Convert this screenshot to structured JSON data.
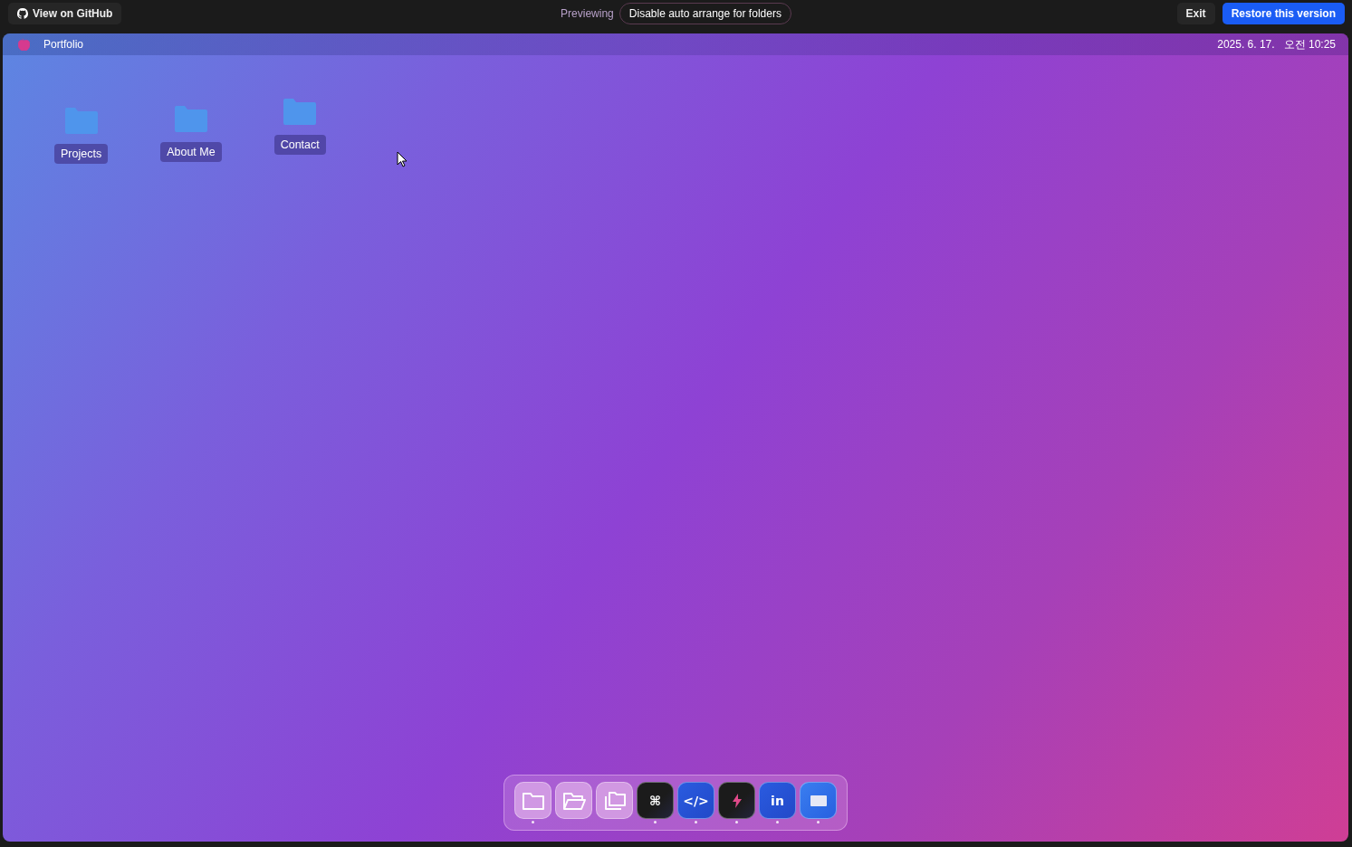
{
  "top_bar": {
    "github_link": "View on GitHub",
    "previewing_label": "Previewing",
    "version_title": "Disable auto arrange for folders",
    "exit_button": "Exit",
    "restore_button": "Restore this version"
  },
  "menu_bar": {
    "app_name": "Portfolio",
    "datetime": "2025. 6. 17.   오전 10:25"
  },
  "desktop_icons": [
    {
      "label": "Projects"
    },
    {
      "label": "About Me"
    },
    {
      "label": "Contact"
    }
  ],
  "dock": [
    {
      "kind": "folder",
      "running": true
    },
    {
      "kind": "folder-open",
      "running": false
    },
    {
      "kind": "folders",
      "running": false
    },
    {
      "kind": "glyph-dark",
      "glyph": "⌘",
      "running": true
    },
    {
      "kind": "glyph-blue",
      "glyph": "</>",
      "running": true
    },
    {
      "kind": "bolt",
      "running": true
    },
    {
      "kind": "glyph-blue",
      "glyph": "in",
      "running": true
    },
    {
      "kind": "mail",
      "running": true
    }
  ]
}
